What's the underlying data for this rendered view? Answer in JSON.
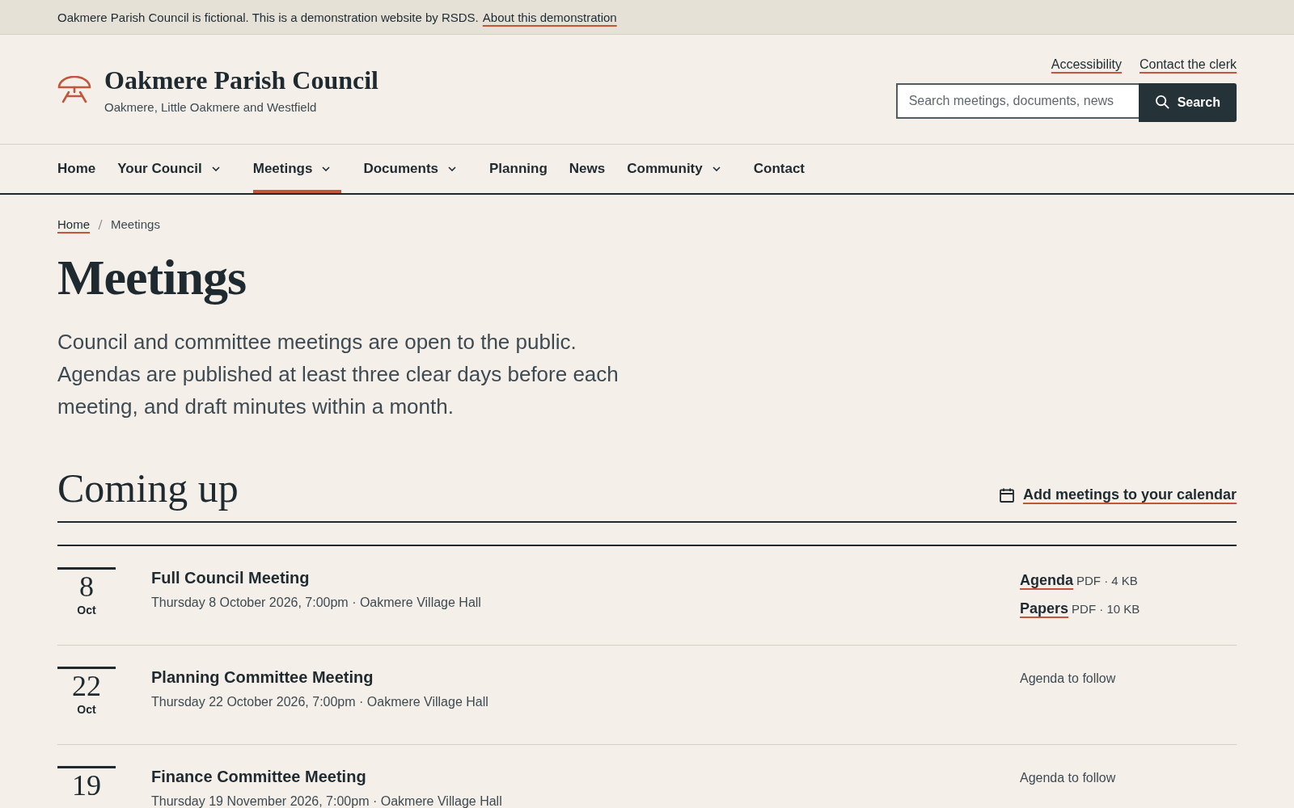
{
  "banner": {
    "text": "Oakmere Parish Council is fictional. This is a demonstration website by RSDS.",
    "link": "About this demonstration"
  },
  "header": {
    "title": "Oakmere Parish Council",
    "subtitle": "Oakmere, Little Oakmere and Westfield",
    "links": [
      "Accessibility",
      "Contact the clerk"
    ],
    "search": {
      "placeholder": "Search meetings, documents, news",
      "button": "Search"
    }
  },
  "nav": [
    {
      "label": "Home",
      "has_menu": false,
      "selected": false
    },
    {
      "label": "Your Council",
      "has_menu": true,
      "selected": false
    },
    {
      "label": "Meetings",
      "has_menu": true,
      "selected": true
    },
    {
      "label": "Documents",
      "has_menu": true,
      "selected": false
    },
    {
      "label": "Planning",
      "has_menu": false,
      "selected": false
    },
    {
      "label": "News",
      "has_menu": false,
      "selected": false
    },
    {
      "label": "Community",
      "has_menu": true,
      "selected": false
    },
    {
      "label": "Contact",
      "has_menu": false,
      "selected": false
    }
  ],
  "breadcrumb": {
    "links": [
      "Home"
    ],
    "current": "Meetings"
  },
  "page_title": "Meetings",
  "intro": "Council and committee meetings are open to the public. Agendas are published at least three clear days before each meeting, and draft minutes within a month.",
  "section": {
    "title": "Coming up",
    "calendar_link": "Add meetings to your calendar"
  },
  "meetings": [
    {
      "day": "8",
      "month": "Oct",
      "title": "Full Council Meeting",
      "details": "Thursday 8 October 2026, 7:00pm · Oakmere Village Hall",
      "documents": [
        {
          "label": "Agenda",
          "meta": "PDF · 4 KB"
        },
        {
          "label": "Papers",
          "meta": "PDF · 10 KB"
        }
      ]
    },
    {
      "day": "22",
      "month": "Oct",
      "title": "Planning Committee Meeting",
      "details": "Thursday 22 October 2026, 7:00pm · Oakmere Village Hall",
      "note": "Agenda to follow"
    },
    {
      "day": "19",
      "title": "Finance Committee Meeting",
      "details": "Thursday 19 November 2026, 7:00pm · Oakmere Village Hall",
      "note": "Agenda to follow"
    }
  ]
}
